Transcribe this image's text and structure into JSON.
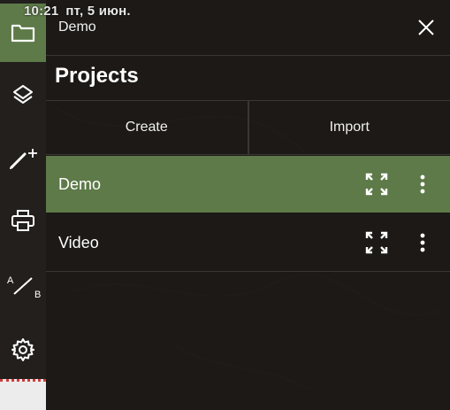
{
  "status_bar": {
    "time": "10:21",
    "date": "пт, 5 июн."
  },
  "toolbar": {
    "items": [
      {
        "name": "folder-icon",
        "active": true
      },
      {
        "name": "layers-icon",
        "active": false
      },
      {
        "name": "brush-add-icon",
        "active": false
      },
      {
        "name": "print-icon",
        "active": false
      },
      {
        "name": "a-b-line-icon",
        "active": false,
        "label_a": "A",
        "label_b": "B"
      },
      {
        "name": "gear-icon",
        "active": false
      }
    ]
  },
  "panel": {
    "header_title": "Demo",
    "section_title": "Projects",
    "create_label": "Create",
    "import_label": "Import",
    "projects": [
      {
        "name": "Demo",
        "selected": true
      },
      {
        "name": "Video",
        "selected": false
      }
    ]
  },
  "colors": {
    "accent": "#5d7a48",
    "panel_bg": "#181512",
    "toolbar_bg": "#221f1c"
  }
}
